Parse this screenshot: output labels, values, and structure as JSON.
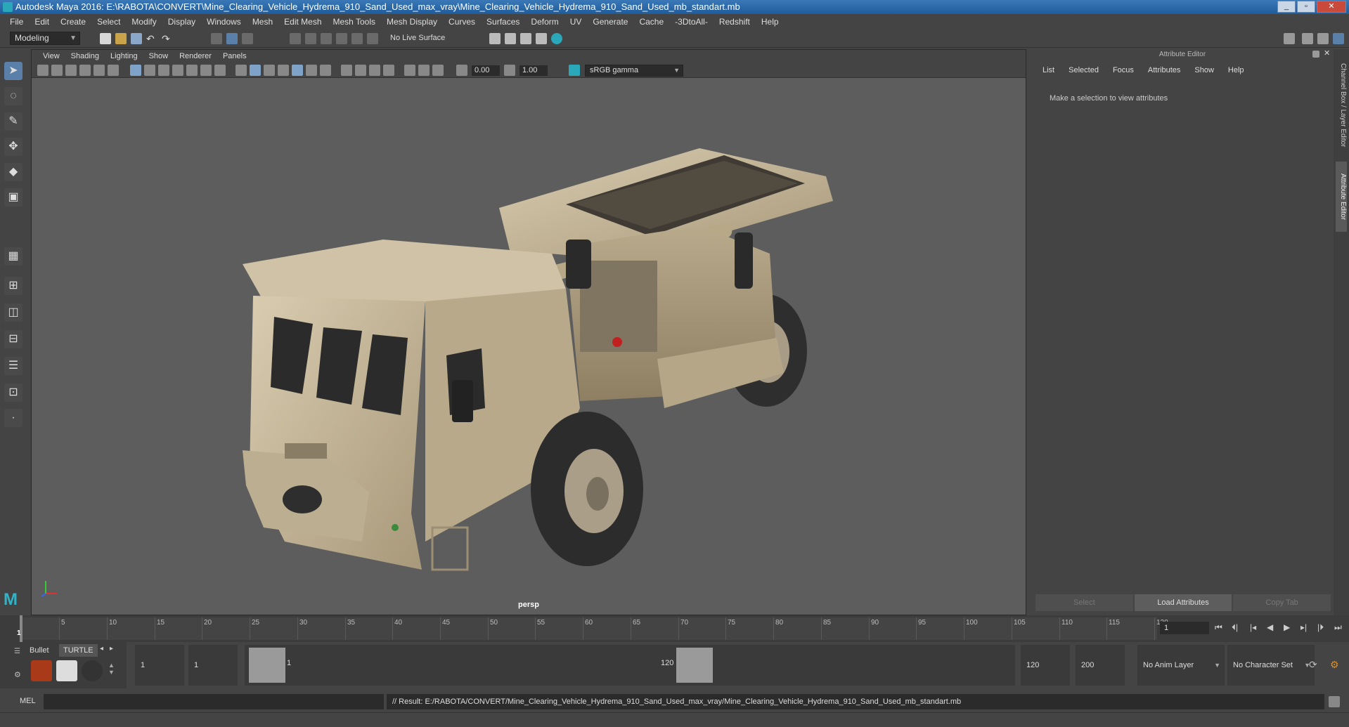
{
  "window": {
    "title": "Autodesk Maya 2016: E:\\RABOTA\\CONVERT\\Mine_Clearing_Vehicle_Hydrema_910_Sand_Used_max_vray\\Mine_Clearing_Vehicle_Hydrema_910_Sand_Used_mb_standart.mb"
  },
  "menu": [
    "File",
    "Edit",
    "Create",
    "Select",
    "Modify",
    "Display",
    "Windows",
    "Mesh",
    "Edit Mesh",
    "Mesh Tools",
    "Mesh Display",
    "Curves",
    "Surfaces",
    "Deform",
    "UV",
    "Generate",
    "Cache",
    "-3DtoAll-",
    "Redshift",
    "Help"
  ],
  "toolbar": {
    "mode": "Modeling",
    "live_surface": "No Live Surface"
  },
  "viewport": {
    "menu": [
      "View",
      "Shading",
      "Lighting",
      "Show",
      "Renderer",
      "Panels"
    ],
    "exposure": "0.00",
    "gamma_value": "1.00",
    "color_space": "sRGB gamma",
    "camera_label": "persp"
  },
  "attribute_editor": {
    "header": "Attribute Editor",
    "menu": [
      "List",
      "Selected",
      "Focus",
      "Attributes",
      "Show",
      "Help"
    ],
    "message": "Make a selection to view attributes",
    "buttons": [
      "Select",
      "Load Attributes",
      "Copy Tab"
    ]
  },
  "side_tabs": [
    "Channel Box / Layer Editor",
    "Attribute Editor"
  ],
  "timeline": {
    "ticks": [
      "5",
      "10",
      "15",
      "20",
      "25",
      "30",
      "35",
      "40",
      "45",
      "50",
      "55",
      "60",
      "65",
      "70",
      "75",
      "80",
      "85",
      "90",
      "95",
      "100",
      "105",
      "110",
      "115",
      "120"
    ],
    "start_label": "1",
    "current_frame": "1"
  },
  "range": {
    "shelf_tabs": [
      "Bullet",
      "TURTLE"
    ],
    "start": "1",
    "playback_start": "1",
    "slider_start": "1",
    "slider_end": "120",
    "playback_end": "120",
    "end": "200",
    "anim_layer": "No Anim Layer",
    "char_set": "No Character Set"
  },
  "command": {
    "lang": "MEL",
    "result": "// Result: E:/RABOTA/CONVERT/Mine_Clearing_Vehicle_Hydrema_910_Sand_Used_max_vray/Mine_Clearing_Vehicle_Hydrema_910_Sand_Used_mb_standart.mb"
  },
  "colors": {
    "viewport_bg": "#5d5d5d",
    "vehicle_sand": "#c4b496",
    "accent": "#5a7fa8"
  }
}
